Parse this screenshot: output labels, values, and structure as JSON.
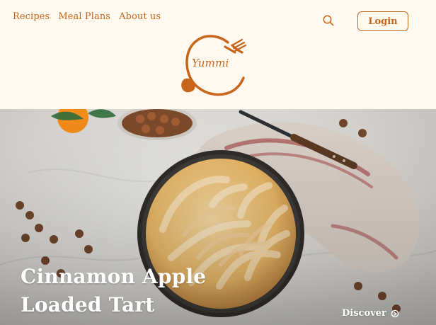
{
  "colors": {
    "brand": "#c8651c",
    "background": "#fff9ef",
    "heroText": "#ffffff"
  },
  "nav": {
    "items": [
      {
        "label": "Recipes"
      },
      {
        "label": "Meal Plans"
      },
      {
        "label": "About us"
      }
    ],
    "search_icon": "search-icon",
    "login_label": "Login"
  },
  "logo": {
    "text": "Yummi"
  },
  "hero": {
    "title_line1": "Cinnamon Apple",
    "title_line2": "Loaded Tart",
    "cta_label": "Discover",
    "cta_icon": "arrow-circle-icon"
  }
}
